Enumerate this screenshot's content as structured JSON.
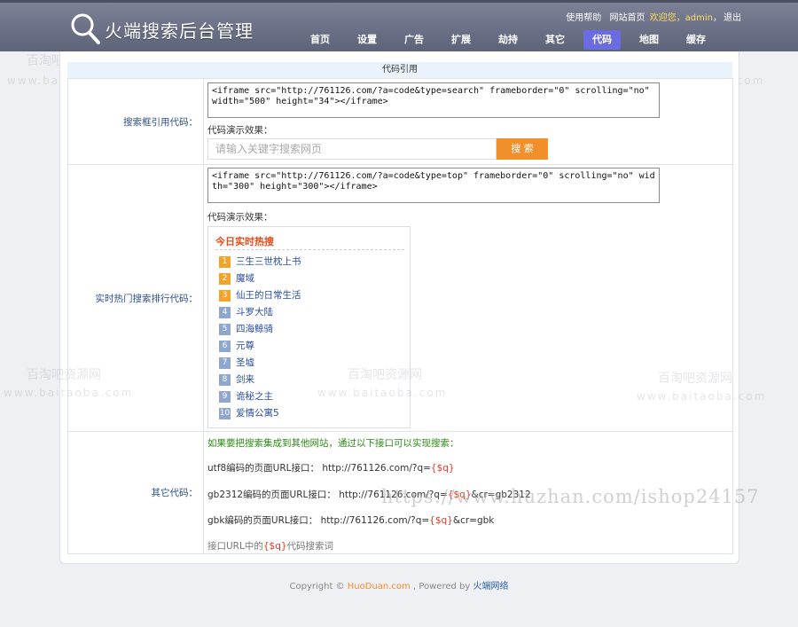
{
  "header": {
    "title": "火端搜索后台管理",
    "logo_icon": "search-icon",
    "toplinks": {
      "help": "使用帮助",
      "home": "网站首页",
      "welcome": "欢迎您，",
      "user": "admin",
      "sep": "，",
      "logout": "退出"
    },
    "nav": [
      {
        "label": "首页",
        "active": false
      },
      {
        "label": "设置",
        "active": false
      },
      {
        "label": "广告",
        "active": false
      },
      {
        "label": "扩展",
        "active": false
      },
      {
        "label": "劫持",
        "active": false
      },
      {
        "label": "其它",
        "active": false
      },
      {
        "label": "代码",
        "active": true
      },
      {
        "label": "地图",
        "active": false
      },
      {
        "label": "缓存",
        "active": false
      }
    ],
    "active_color": "#6a6ce0"
  },
  "panel": {
    "title": "代码引用",
    "search_code": {
      "label": "搜索框引用代码：",
      "code": "<iframe src=\"http://761126.com/?a=code&type=search\" frameborder=\"0\" scrolling=\"no\" width=\"500\" height=\"34\"></iframe>",
      "demo_label": "代码演示效果：",
      "input_placeholder": "请输入关键字搜索网页",
      "button": "搜 索"
    },
    "hot_code": {
      "label": "实时热门搜索排行代码：",
      "code": "<iframe src=\"http://761126.com/?a=code&type=top\" frameborder=\"0\" scrolling=\"no\" width=\"300\" height=\"300\"></iframe>",
      "demo_label": "代码演示效果：",
      "box_title": "今日实时热搜",
      "items": [
        {
          "num": "1",
          "text": "三生三世枕上书"
        },
        {
          "num": "2",
          "text": "魔域"
        },
        {
          "num": "3",
          "text": "仙王的日常生活"
        },
        {
          "num": "4",
          "text": "斗罗大陆"
        },
        {
          "num": "5",
          "text": "四海鲸骑"
        },
        {
          "num": "6",
          "text": "元尊"
        },
        {
          "num": "7",
          "text": "圣墟"
        },
        {
          "num": "8",
          "text": "剑来"
        },
        {
          "num": "9",
          "text": "诡秘之主"
        },
        {
          "num": "10",
          "text": "爱情公寓5"
        }
      ]
    },
    "other_code": {
      "label": "其它代码：",
      "intro": "如果要把搜索集成到其他网站，通过以下接口可以实现搜索：",
      "utf8_prefix": "utf8编码的页面URL接口： http://761126.com/?q=",
      "utf8_var": "{$q}",
      "gb_prefix": "gb2312编码的页面URL接口： http://761126.com/?q=",
      "gb_var": "{$q}",
      "gb_suffix": "&cr=gb2312",
      "gbk_prefix": "gbk编码的页面URL接口： http://761126.com/?q=",
      "gbk_var": "{$q}",
      "gbk_suffix": "&cr=gbk",
      "note_prefix": "接口URL中的",
      "note_var": "{$q}",
      "note_suffix": "代码搜索词"
    }
  },
  "footer": {
    "copyright": "Copyright © ",
    "site": "HuoDuan.com",
    "powered": " , Powered by ",
    "brand": "火端网络"
  },
  "watermarks": {
    "cn": "百淘吧资源网",
    "en": "www.baitaoba.com",
    "big": "https://www.huzhan.com/ishop24157"
  }
}
